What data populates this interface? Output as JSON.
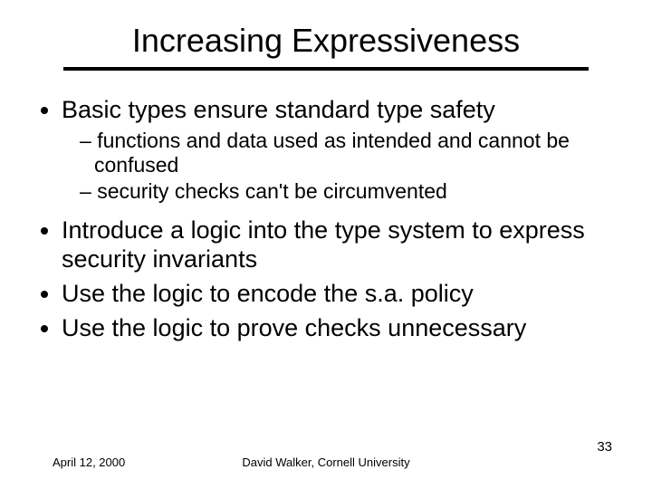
{
  "title": "Increasing Expressiveness",
  "bullets": {
    "b1": "Basic types ensure standard type safety",
    "b1_sub1": "functions and data used as intended and cannot be confused",
    "b1_sub2": "security checks can't be circumvented",
    "b2": "Introduce a logic into the type system to express security invariants",
    "b3": "Use the logic to encode the s.a. policy",
    "b4": "Use the logic to prove checks unnecessary"
  },
  "footer": {
    "date": "April 12, 2000",
    "author": "David Walker, Cornell University",
    "page": "33"
  }
}
